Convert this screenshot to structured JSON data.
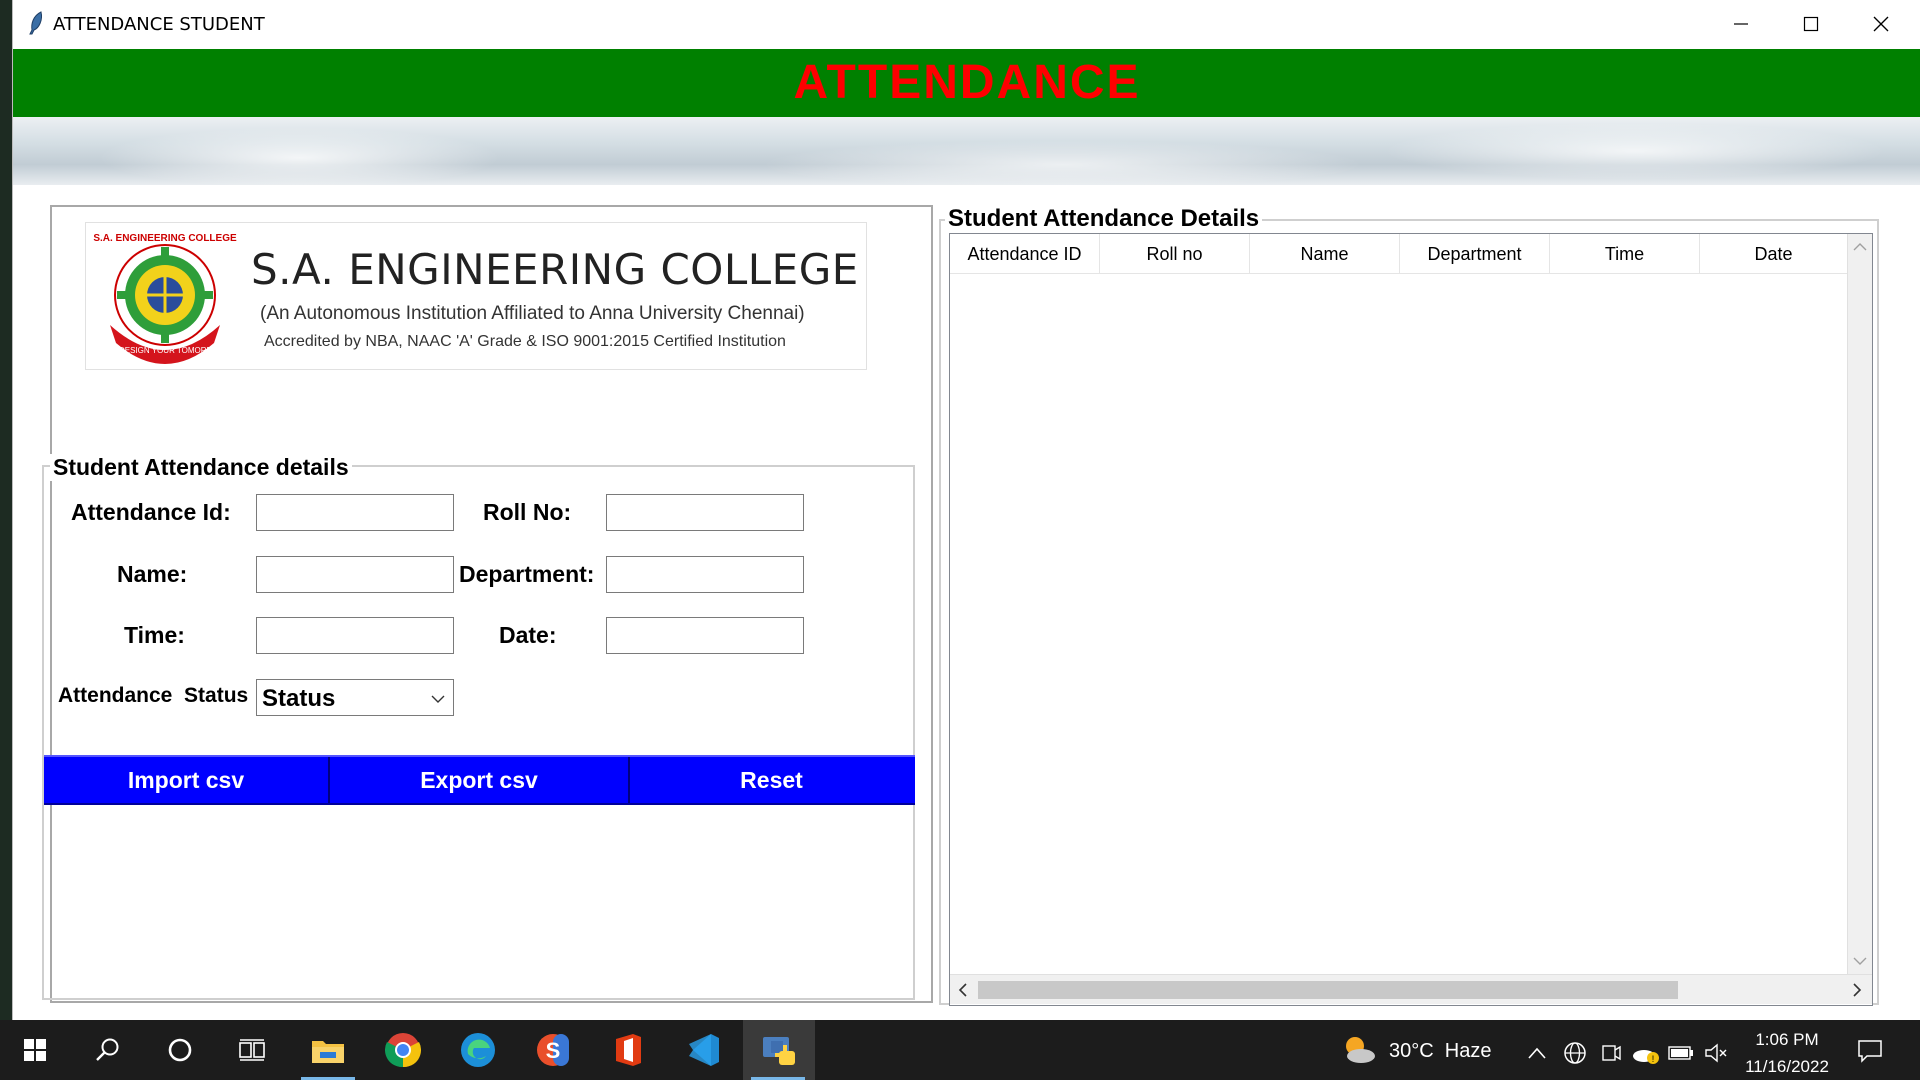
{
  "window": {
    "title": "ATTENDANCE STUDENT",
    "controls": {
      "minimize": "—",
      "maximize": "☐",
      "close": "✕"
    }
  },
  "banner": {
    "title": "ATTENDANCE",
    "bg_color": "#008000",
    "text_color": "#ff0000"
  },
  "logo": {
    "college_name": "S.A. ENGINEERING COLLEGE",
    "subtitle": "(An Autonomous Institution Affiliated to Anna University Chennai)",
    "accreditation": "Accredited by NBA, NAAC 'A' Grade & ISO 9001:2015 Certified Institution",
    "emblem_top_text": "S.A. ENGINEERING COLLEGE",
    "emblem_ribbon_text": "WE DESIGN YOUR TOMORROW"
  },
  "form": {
    "section_title": "Student Attendance details",
    "labels": {
      "attendance_id": "Attendance Id:",
      "roll_no": "Roll No:",
      "name": "Name:",
      "department": "Department:",
      "time": "Time:",
      "date": "Date:",
      "status": "Attendance  Status"
    },
    "values": {
      "attendance_id": "",
      "roll_no": "",
      "name": "",
      "department": "",
      "time": "",
      "date": ""
    },
    "status_selected": "Status"
  },
  "buttons": {
    "import": "Import csv",
    "export": "Export csv",
    "reset": "Reset",
    "color": "#0000ff"
  },
  "table": {
    "section_title": "Student Attendance Details",
    "columns": [
      "Attendance ID",
      "Roll no",
      "Name",
      "Department",
      "Time",
      "Date"
    ],
    "rows": []
  },
  "taskbar": {
    "weather": "30°C  Haze",
    "time": "1:06 PM",
    "date": "11/16/2022"
  }
}
